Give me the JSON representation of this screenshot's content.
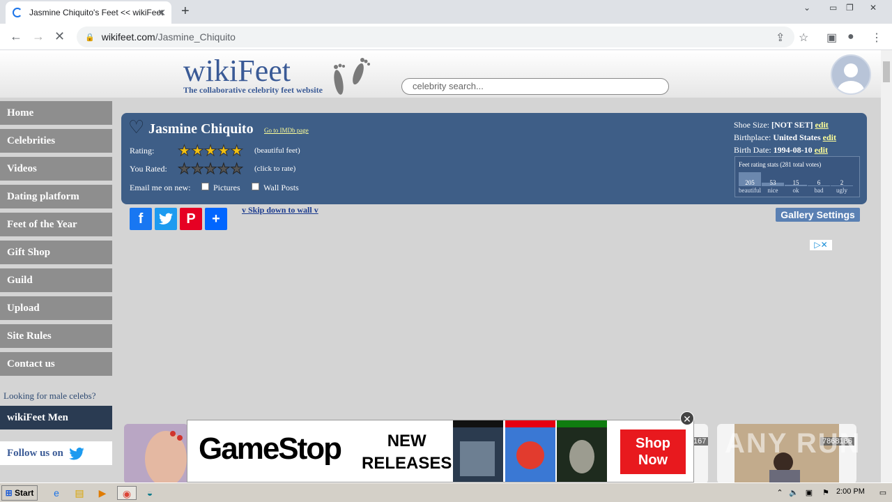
{
  "browser": {
    "tab_title": "Jasmine Chiquito's Feet << wikiFeet",
    "url_host": "wikifeet.com",
    "url_path": "/Jasmine_Chiquito"
  },
  "site": {
    "logo_text": "wikiFeet",
    "tagline": "The collaborative celebrity feet website",
    "search_placeholder": "celebrity search..."
  },
  "sidebar": {
    "items": [
      "Home",
      "Celebrities",
      "Videos",
      "Dating platform",
      "Feet of the Year",
      "Gift Shop",
      "Guild",
      "Upload",
      "Site Rules",
      "Contact us"
    ],
    "male_prompt": "Looking for male celebs?",
    "men_link": "wikiFeet Men",
    "follow": "Follow us on"
  },
  "profile": {
    "name": "Jasmine Chiquito",
    "imdb_link": "Go to IMDb page",
    "rating_label": "Rating:",
    "rating_note": "(beautiful feet)",
    "rating_stars": 5,
    "you_rated_label": "You Rated:",
    "you_rated_note": "(click to rate)",
    "email_label": "Email me on new:",
    "pictures_label": "Pictures",
    "wall_posts_label": "Wall Posts",
    "shoe_size_label": "Shoe Size:",
    "shoe_size": "[NOT SET]",
    "birthplace_label": "Birthplace:",
    "birthplace": "United States",
    "birth_date_label": "Birth Date:",
    "birth_date": "1994-08-10",
    "edit_label": "edit",
    "stats_title": "Feet rating stats (281 total votes)",
    "stats": [
      {
        "count": "205",
        "label": "beautiful"
      },
      {
        "count": "53",
        "label": "nice"
      },
      {
        "count": "15",
        "label": "ok"
      },
      {
        "count": "6",
        "label": "bad"
      },
      {
        "count": "2",
        "label": "ugly"
      }
    ]
  },
  "actions": {
    "skip_link": "v Skip down to wall v",
    "gallery_settings": "Gallery Settings"
  },
  "ad": {
    "brand": "GameStop",
    "headline_1": "NEW",
    "headline_2": "RELEASES",
    "cta_1": "Shop",
    "cta_2": "Now"
  },
  "thumbs": [
    {
      "id": "167"
    },
    {
      "id": "7868186"
    }
  ],
  "taskbar": {
    "start": "Start",
    "clock": "2:00 PM"
  },
  "watermark": "ANY RUN"
}
